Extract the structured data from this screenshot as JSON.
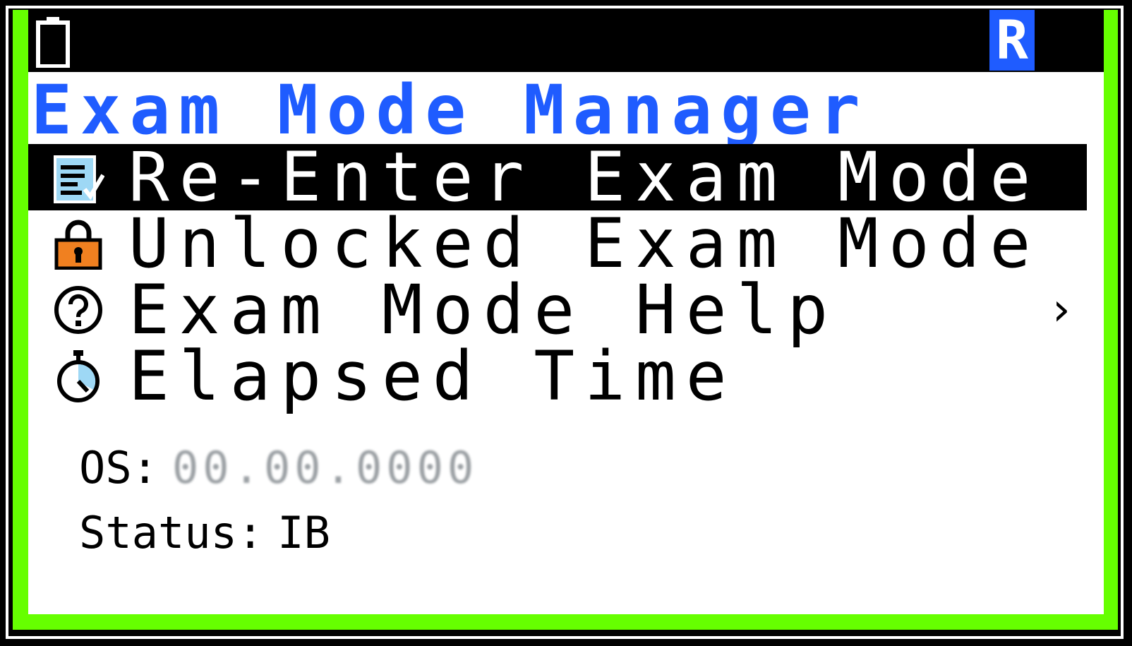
{
  "status_bar": {
    "battery_icon": "battery-icon",
    "mode_badge": "R"
  },
  "title": "Exam Mode Manager",
  "menu": {
    "items": [
      {
        "label": "Re-Enter Exam Mode",
        "icon": "notepad-check-icon",
        "selected": true
      },
      {
        "label": "Unlocked Exam Mode",
        "icon": "padlock-icon",
        "selected": false
      },
      {
        "label": "Exam Mode Help",
        "icon": "question-circle-icon",
        "chevron": "›",
        "selected": false
      },
      {
        "label": "Elapsed Time",
        "icon": "stopwatch-icon",
        "selected": false
      }
    ]
  },
  "info": {
    "os_label": "OS:",
    "os_value": "00.00.0000",
    "status_label": "Status:",
    "status_value": "IB"
  },
  "colors": {
    "accent_blue": "#1f5cff",
    "frame_green": "#66ff00",
    "padlock_orange": "#f08020",
    "icon_light_blue": "#9ed8f5"
  }
}
